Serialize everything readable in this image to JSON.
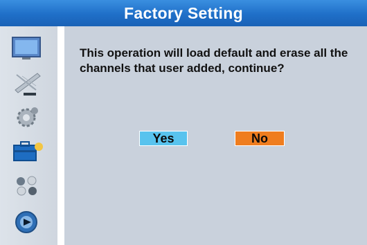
{
  "dialog": {
    "title": "Factory Setting",
    "message": "This operation will load default and erase all the channels that user added, continue?",
    "yes_label": "Yes",
    "no_label": "No"
  },
  "sidebar": {
    "items": [
      {
        "icon": "tv-screen-icon"
      },
      {
        "icon": "satellite-dish-icon"
      },
      {
        "icon": "gear-icon"
      },
      {
        "icon": "toolbox-icon",
        "selected": true
      },
      {
        "icon": "media-balls-icon"
      },
      {
        "icon": "disc-player-icon"
      }
    ]
  },
  "colors": {
    "title_bar": "#1f6fc8",
    "main_bg": "#c9d1dc",
    "yes_button": "#58c3ee",
    "no_button": "#ef7d1f"
  }
}
